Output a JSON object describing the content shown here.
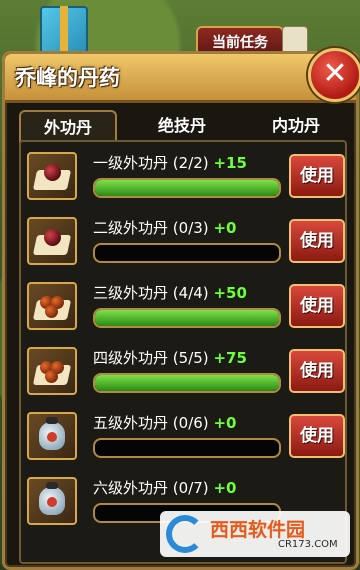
{
  "hud": {
    "current_task_label": "当前任务"
  },
  "panel": {
    "title": "乔峰的丹药",
    "close_label": "✕"
  },
  "tabs": [
    {
      "label": "外功丹",
      "active": true
    },
    {
      "label": "绝技丹",
      "active": false
    },
    {
      "label": "内功丹",
      "active": false
    }
  ],
  "items": [
    {
      "name": "一级外功丹",
      "count": "(2/2)",
      "bonus": "+15",
      "button": "使用",
      "progress": 1.0,
      "icon": "single-red-pill-icon"
    },
    {
      "name": "二级外功丹",
      "count": "(0/3)",
      "bonus": "+0",
      "button": "使用",
      "progress": 0.0,
      "icon": "single-red-pill-icon"
    },
    {
      "name": "三级外功丹",
      "count": "(4/4)",
      "bonus": "+50",
      "button": "使用",
      "progress": 1.0,
      "icon": "triple-orange-pill-icon"
    },
    {
      "name": "四级外功丹",
      "count": "(5/5)",
      "bonus": "+75",
      "button": "使用",
      "progress": 1.0,
      "icon": "triple-orange-pill-icon"
    },
    {
      "name": "五级外功丹",
      "count": "(0/6)",
      "bonus": "+0",
      "button": "使用",
      "progress": 0.0,
      "icon": "potion-bottle-icon"
    },
    {
      "name": "六级外功丹",
      "count": "(0/7)",
      "bonus": "+0",
      "button": "",
      "progress": 0.0,
      "icon": "potion-bottle-icon"
    }
  ],
  "watermark": {
    "brand": "西西软件园",
    "domain": "CR173.COM"
  }
}
